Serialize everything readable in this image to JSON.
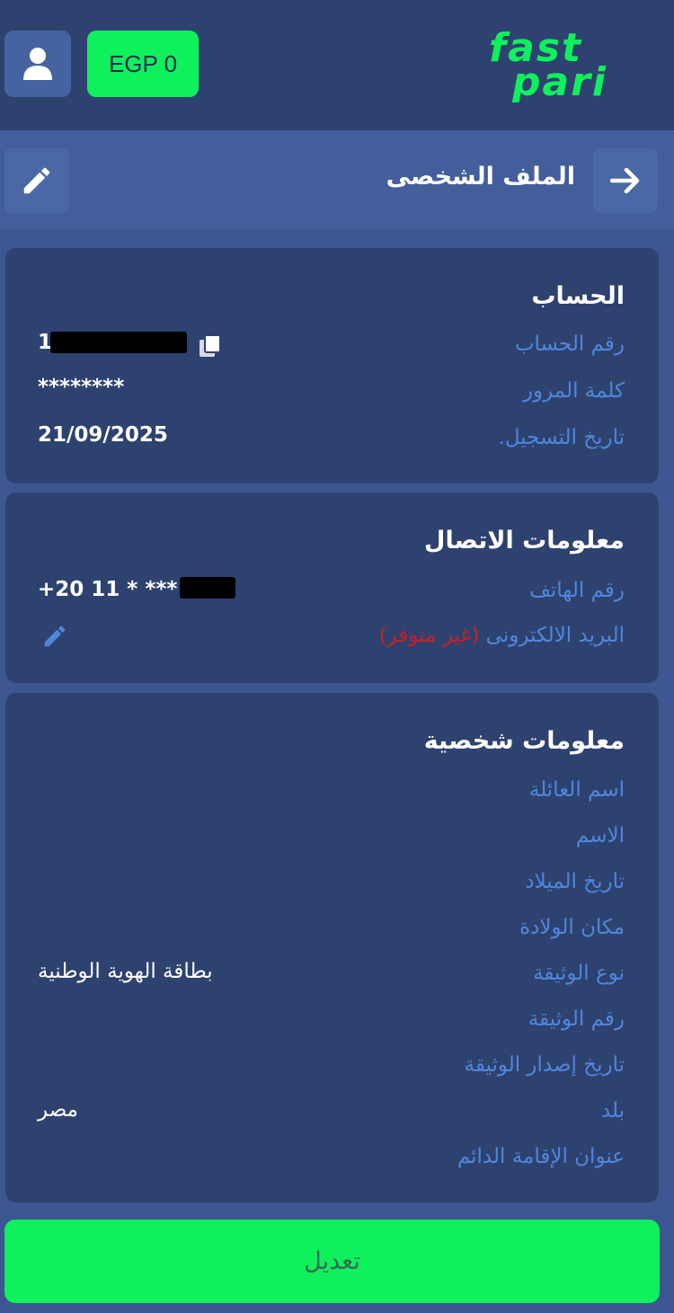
{
  "header": {
    "balance": "EGP 0",
    "logo_line1": "fast",
    "logo_line2": "pari",
    "avatar_icon": "user-icon",
    "brand_color": "#0ff15c"
  },
  "subheader": {
    "title": "الملف الشخصى",
    "back_icon": "arrow-right-icon",
    "edit_icon": "pencil-icon"
  },
  "account": {
    "title": "الحساب",
    "account_number_label": "رقم الحساب",
    "account_number_value": "1",
    "password_label": "كلمة المرور",
    "password_value": "********",
    "registration_date_label": "تاريخ التسجيل.",
    "registration_date_value": "21/09/2025"
  },
  "contact": {
    "title": "معلومات الاتصال",
    "phone_label": "رقم الهاتف",
    "phone_value": "+20 11 * *** *",
    "email_label": "البريد الالكترونى",
    "email_status": "(غير متوفر)"
  },
  "personal": {
    "title": "معلومات شخصية",
    "fields": [
      {
        "label": "اسم العائلة",
        "value": ""
      },
      {
        "label": "الاسم",
        "value": ""
      },
      {
        "label": "تاريخ الميلاد",
        "value": ""
      },
      {
        "label": "مكان الولادة",
        "value": ""
      },
      {
        "label": "نوع الوثيقة",
        "value": "بطاقة الهوية الوطنية"
      },
      {
        "label": "رقم الوثيقة",
        "value": ""
      },
      {
        "label": "تاريخ إصدار الوثيقة",
        "value": ""
      },
      {
        "label": "بلد",
        "value": "مصر"
      },
      {
        "label": "عنوان الإقامة الدائم",
        "value": ""
      }
    ]
  },
  "footer": {
    "edit_label": "تعديل"
  }
}
